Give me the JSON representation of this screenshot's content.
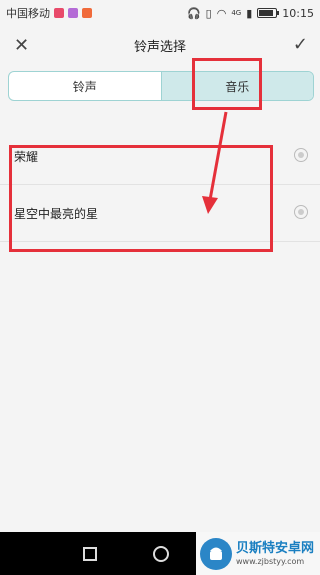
{
  "status_bar": {
    "carrier": "中国移动",
    "network": "4G",
    "time": "10:15",
    "battery_level": 0.85
  },
  "header": {
    "title": "铃声选择",
    "close_icon": "close-icon",
    "confirm_icon": "check-icon"
  },
  "tabs": [
    {
      "label": "铃声",
      "active": false
    },
    {
      "label": "音乐",
      "active": true
    }
  ],
  "songs": [
    {
      "title": "荣耀"
    },
    {
      "title": "星空中最亮的星"
    }
  ],
  "annotation_color": "#e5303a",
  "watermark": {
    "title": "贝斯特安卓网",
    "url": "www.zjbstyy.com"
  }
}
